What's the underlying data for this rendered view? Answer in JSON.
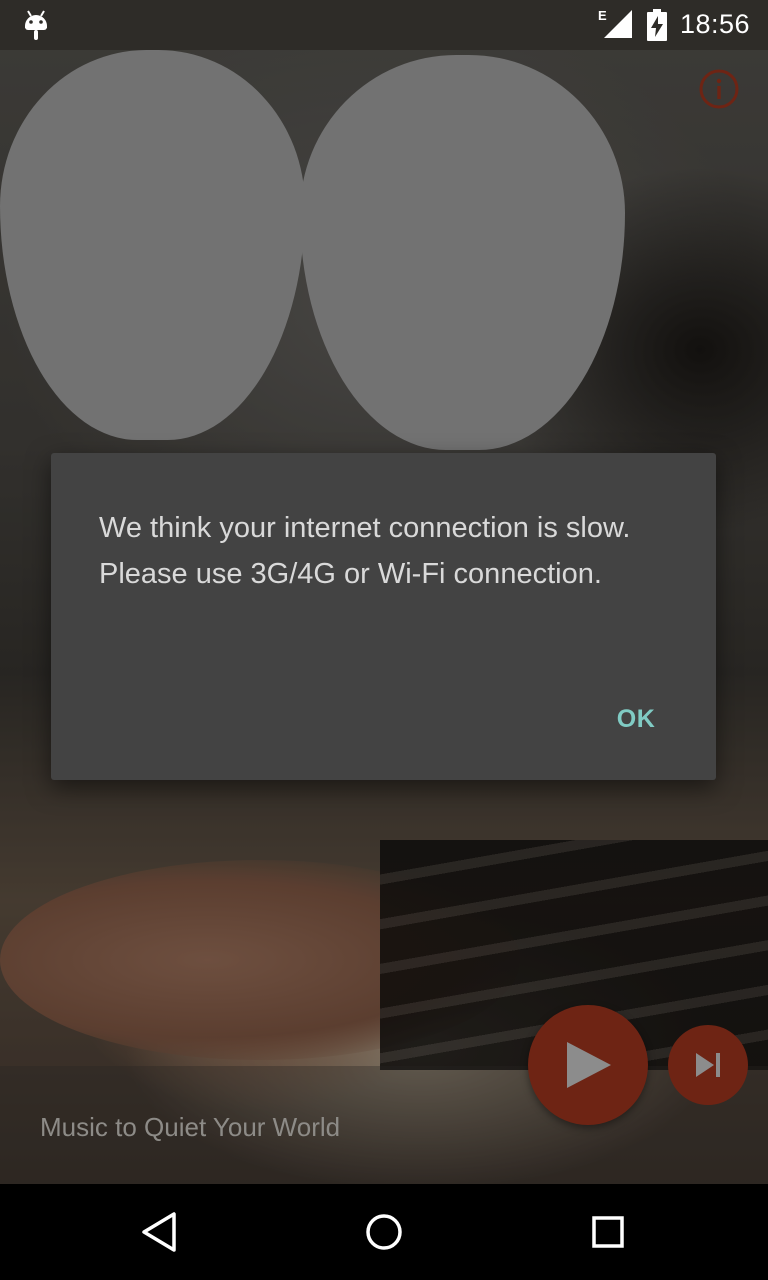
{
  "status_bar": {
    "time": "18:56",
    "network_type": "E",
    "icons": [
      "android-debug-icon",
      "signal-icon",
      "battery-charging-icon"
    ]
  },
  "app": {
    "now_playing_title": "Music to Quiet Your World",
    "accent_color": "#6e2414",
    "icons": [
      "info-icon",
      "play-icon",
      "skip-next-icon"
    ]
  },
  "dialog": {
    "message": "We think your internet connection is slow. Please use 3G/4G or Wi-Fi connection.",
    "ok_label": "OK",
    "ok_color": "#80cbc4"
  },
  "nav_bar": {
    "icons": [
      "back-icon",
      "home-icon",
      "recents-icon"
    ]
  }
}
